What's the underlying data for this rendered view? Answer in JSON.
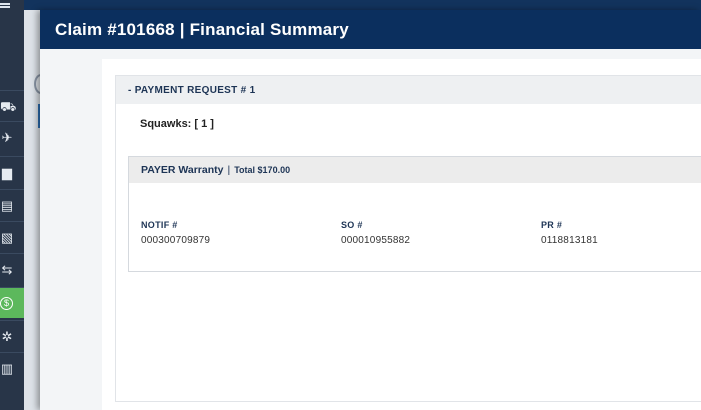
{
  "nav": {
    "items": [
      {
        "name": "truck-icon",
        "glyph": "⛟"
      },
      {
        "name": "airplane-icon",
        "glyph": "✈"
      },
      {
        "name": "cart-icon",
        "glyph": "▆"
      },
      {
        "name": "document-icon",
        "glyph": "▤"
      },
      {
        "name": "document-arrow-icon",
        "glyph": "▧"
      },
      {
        "name": "exchange-icon",
        "glyph": "⇆"
      },
      {
        "name": "dollar-icon",
        "glyph": "$"
      },
      {
        "name": "network-icon",
        "glyph": "✲"
      },
      {
        "name": "bar-chart-icon",
        "glyph": "▥"
      }
    ],
    "active_color": "#5cb85c"
  },
  "panel": {
    "title": "Claim #101668 | Financial Summary",
    "header_color": "#0b2f5e"
  },
  "payment_request": {
    "title": "- PAYMENT REQUEST # 1",
    "squawks": "Squawks: [ 1 ]"
  },
  "payer": {
    "label": "PAYER Warranty",
    "separator": "|",
    "total": "Total $170.00"
  },
  "fields": [
    {
      "label": "NOTIF #",
      "value": "000300709879"
    },
    {
      "label": "SO #",
      "value": "000010955882"
    },
    {
      "label": "PR #",
      "value": "0118813181"
    }
  ]
}
